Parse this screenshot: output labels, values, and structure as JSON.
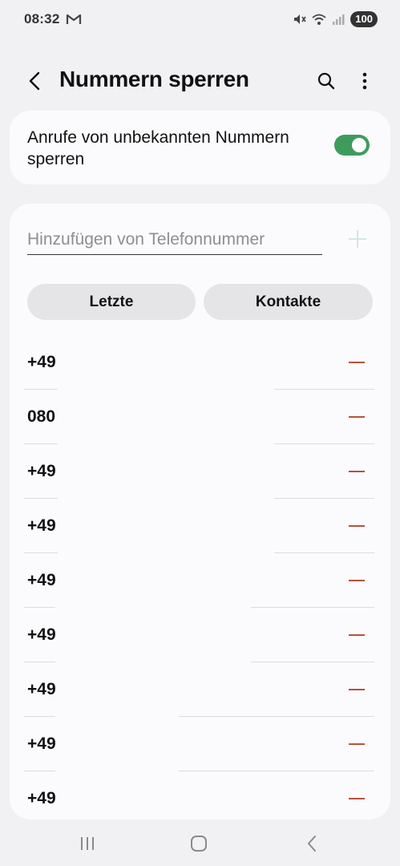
{
  "status_bar": {
    "time": "08:32",
    "battery": "100",
    "icons": [
      "gmail-icon",
      "mute-icon",
      "wifi-icon",
      "signal-icon"
    ]
  },
  "app_bar": {
    "title": "Nummern sperren",
    "icons": [
      "back-icon",
      "search-icon",
      "more-vertical-icon"
    ]
  },
  "block_unknown": {
    "label": "Anrufe von unbekannten Nummern sperren",
    "enabled": true,
    "accent": "#3d9c5c"
  },
  "add_number": {
    "placeholder": "Hinzufügen von Telefonnummer",
    "value": "",
    "add_icon": "plus-icon"
  },
  "tabs": {
    "recent_label": "Letzte",
    "contacts_label": "Kontakte"
  },
  "blocked_numbers": [
    {
      "number": "+49"
    },
    {
      "number": "080"
    },
    {
      "number": "+49"
    },
    {
      "number": "+49"
    },
    {
      "number": "+49"
    },
    {
      "number": "+49"
    },
    {
      "number": "+49"
    },
    {
      "number": "+49"
    },
    {
      "number": "+49"
    }
  ],
  "remove_icon": "minus-icon",
  "remove_color": "#b5523f",
  "nav_bar": {
    "icons": [
      "recents-icon",
      "home-icon",
      "back-nav-icon"
    ]
  }
}
